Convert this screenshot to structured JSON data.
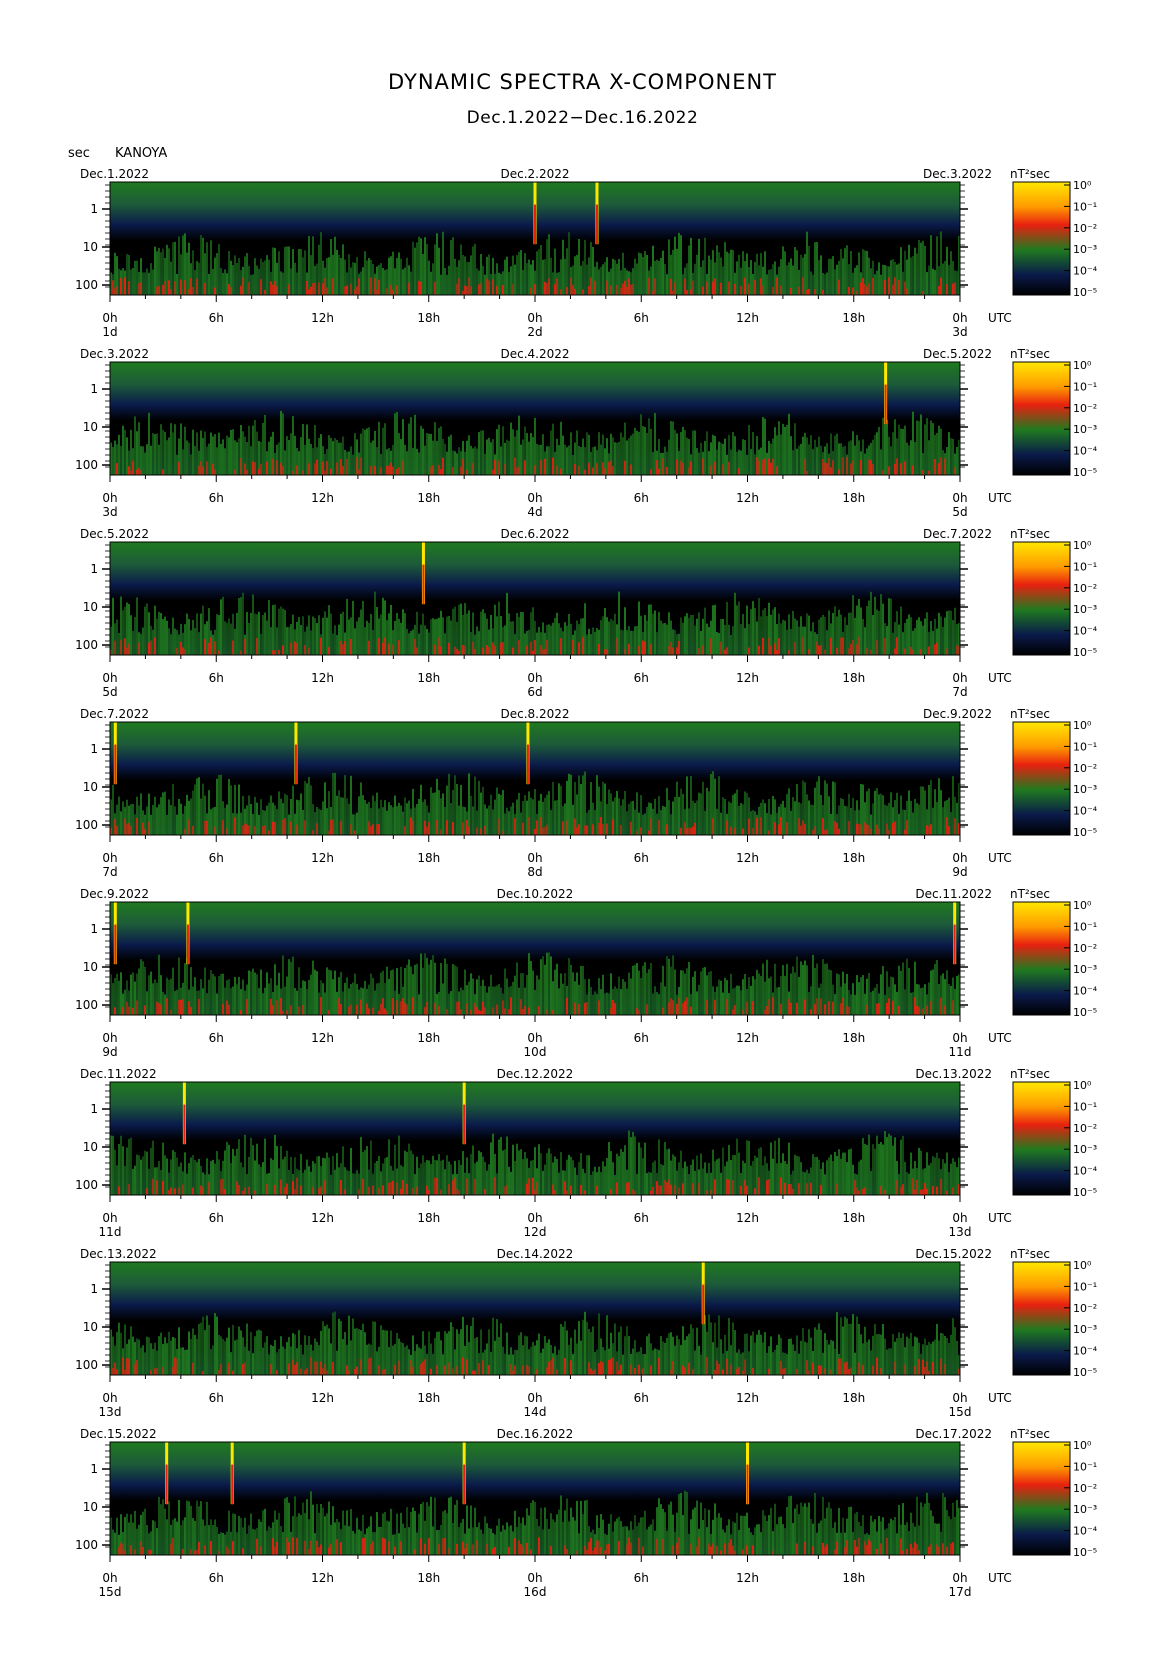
{
  "title": "DYNAMIC SPECTRA X-COMPONENT",
  "subtitle": "Dec.1.2022−Dec.16.2022",
  "unit_label": "sec",
  "station": "KANOYA",
  "colorbar_unit": "nT²sec",
  "utc_label": "UTC",
  "colors": {
    "background": "#000000",
    "low": "#0a1a4a",
    "mid": "#1f7a1f",
    "high": "#e82010",
    "max": "#ffe800"
  },
  "chart_data": [
    {
      "type": "heatmap",
      "date_labels": [
        "Dec.1.2022",
        "Dec.2.2022",
        "Dec.3.2022"
      ],
      "x_tick_labels": [
        "0h",
        "6h",
        "12h",
        "18h",
        "0h",
        "6h",
        "12h",
        "18h",
        "0h"
      ],
      "day_labels": [
        "1d",
        "2d",
        "3d"
      ],
      "y_tick_labels": [
        "1",
        "10",
        "100"
      ],
      "colorbar_labels": [
        "10⁰",
        "10⁻¹",
        "10⁻²",
        "10⁻³",
        "10⁻⁴",
        "10⁻⁵"
      ],
      "spikes_hours": [
        24.0,
        27.5
      ]
    },
    {
      "type": "heatmap",
      "date_labels": [
        "Dec.3.2022",
        "Dec.4.2022",
        "Dec.5.2022"
      ],
      "x_tick_labels": [
        "0h",
        "6h",
        "12h",
        "18h",
        "0h",
        "6h",
        "12h",
        "18h",
        "0h"
      ],
      "day_labels": [
        "3d",
        "4d",
        "5d"
      ],
      "y_tick_labels": [
        "1",
        "10",
        "100"
      ],
      "colorbar_labels": [
        "10⁰",
        "10⁻¹",
        "10⁻²",
        "10⁻³",
        "10⁻⁴",
        "10⁻⁵"
      ],
      "spikes_hours": [
        43.8
      ]
    },
    {
      "type": "heatmap",
      "date_labels": [
        "Dec.5.2022",
        "Dec.6.2022",
        "Dec.7.2022"
      ],
      "x_tick_labels": [
        "0h",
        "6h",
        "12h",
        "18h",
        "0h",
        "6h",
        "12h",
        "18h",
        "0h"
      ],
      "day_labels": [
        "5d",
        "6d",
        "7d"
      ],
      "y_tick_labels": [
        "1",
        "10",
        "100"
      ],
      "colorbar_labels": [
        "10⁰",
        "10⁻¹",
        "10⁻²",
        "10⁻³",
        "10⁻⁴",
        "10⁻⁵"
      ],
      "spikes_hours": [
        17.7
      ]
    },
    {
      "type": "heatmap",
      "date_labels": [
        "Dec.7.2022",
        "Dec.8.2022",
        "Dec.9.2022"
      ],
      "x_tick_labels": [
        "0h",
        "6h",
        "12h",
        "18h",
        "0h",
        "6h",
        "12h",
        "18h",
        "0h"
      ],
      "day_labels": [
        "7d",
        "8d",
        "9d"
      ],
      "y_tick_labels": [
        "1",
        "10",
        "100"
      ],
      "colorbar_labels": [
        "10⁰",
        "10⁻¹",
        "10⁻²",
        "10⁻³",
        "10⁻⁴",
        "10⁻⁵"
      ],
      "spikes_hours": [
        0.3,
        10.5,
        23.6
      ]
    },
    {
      "type": "heatmap",
      "date_labels": [
        "Dec.9.2022",
        "Dec.10.2022",
        "Dec.11.2022"
      ],
      "x_tick_labels": [
        "0h",
        "6h",
        "12h",
        "18h",
        "0h",
        "6h",
        "12h",
        "18h",
        "0h"
      ],
      "day_labels": [
        "9d",
        "10d",
        "11d"
      ],
      "y_tick_labels": [
        "1",
        "10",
        "100"
      ],
      "colorbar_labels": [
        "10⁰",
        "10⁻¹",
        "10⁻²",
        "10⁻³",
        "10⁻⁴",
        "10⁻⁵"
      ],
      "spikes_hours": [
        0.3,
        4.4,
        47.7
      ]
    },
    {
      "type": "heatmap",
      "date_labels": [
        "Dec.11.2022",
        "Dec.12.2022",
        "Dec.13.2022"
      ],
      "x_tick_labels": [
        "0h",
        "6h",
        "12h",
        "18h",
        "0h",
        "6h",
        "12h",
        "18h",
        "0h"
      ],
      "day_labels": [
        "11d",
        "12d",
        "13d"
      ],
      "y_tick_labels": [
        "1",
        "10",
        "100"
      ],
      "colorbar_labels": [
        "10⁰",
        "10⁻¹",
        "10⁻²",
        "10⁻³",
        "10⁻⁴",
        "10⁻⁵"
      ],
      "spikes_hours": [
        4.2,
        20.0
      ]
    },
    {
      "type": "heatmap",
      "date_labels": [
        "Dec.13.2022",
        "Dec.14.2022",
        "Dec.15.2022"
      ],
      "x_tick_labels": [
        "0h",
        "6h",
        "12h",
        "18h",
        "0h",
        "6h",
        "12h",
        "18h",
        "0h"
      ],
      "day_labels": [
        "13d",
        "14d",
        "15d"
      ],
      "y_tick_labels": [
        "1",
        "10",
        "100"
      ],
      "colorbar_labels": [
        "10⁰",
        "10⁻¹",
        "10⁻²",
        "10⁻³",
        "10⁻⁴",
        "10⁻⁵"
      ],
      "spikes_hours": [
        33.5
      ]
    },
    {
      "type": "heatmap",
      "date_labels": [
        "Dec.15.2022",
        "Dec.16.2022",
        "Dec.17.2022"
      ],
      "x_tick_labels": [
        "0h",
        "6h",
        "12h",
        "18h",
        "0h",
        "6h",
        "12h",
        "18h",
        "0h"
      ],
      "day_labels": [
        "15d",
        "16d",
        "17d"
      ],
      "y_tick_labels": [
        "1",
        "10",
        "100"
      ],
      "colorbar_labels": [
        "10⁰",
        "10⁻¹",
        "10⁻²",
        "10⁻³",
        "10⁻⁴",
        "10⁻⁵"
      ],
      "spikes_hours": [
        3.2,
        6.9,
        20.0,
        36.0
      ]
    }
  ]
}
